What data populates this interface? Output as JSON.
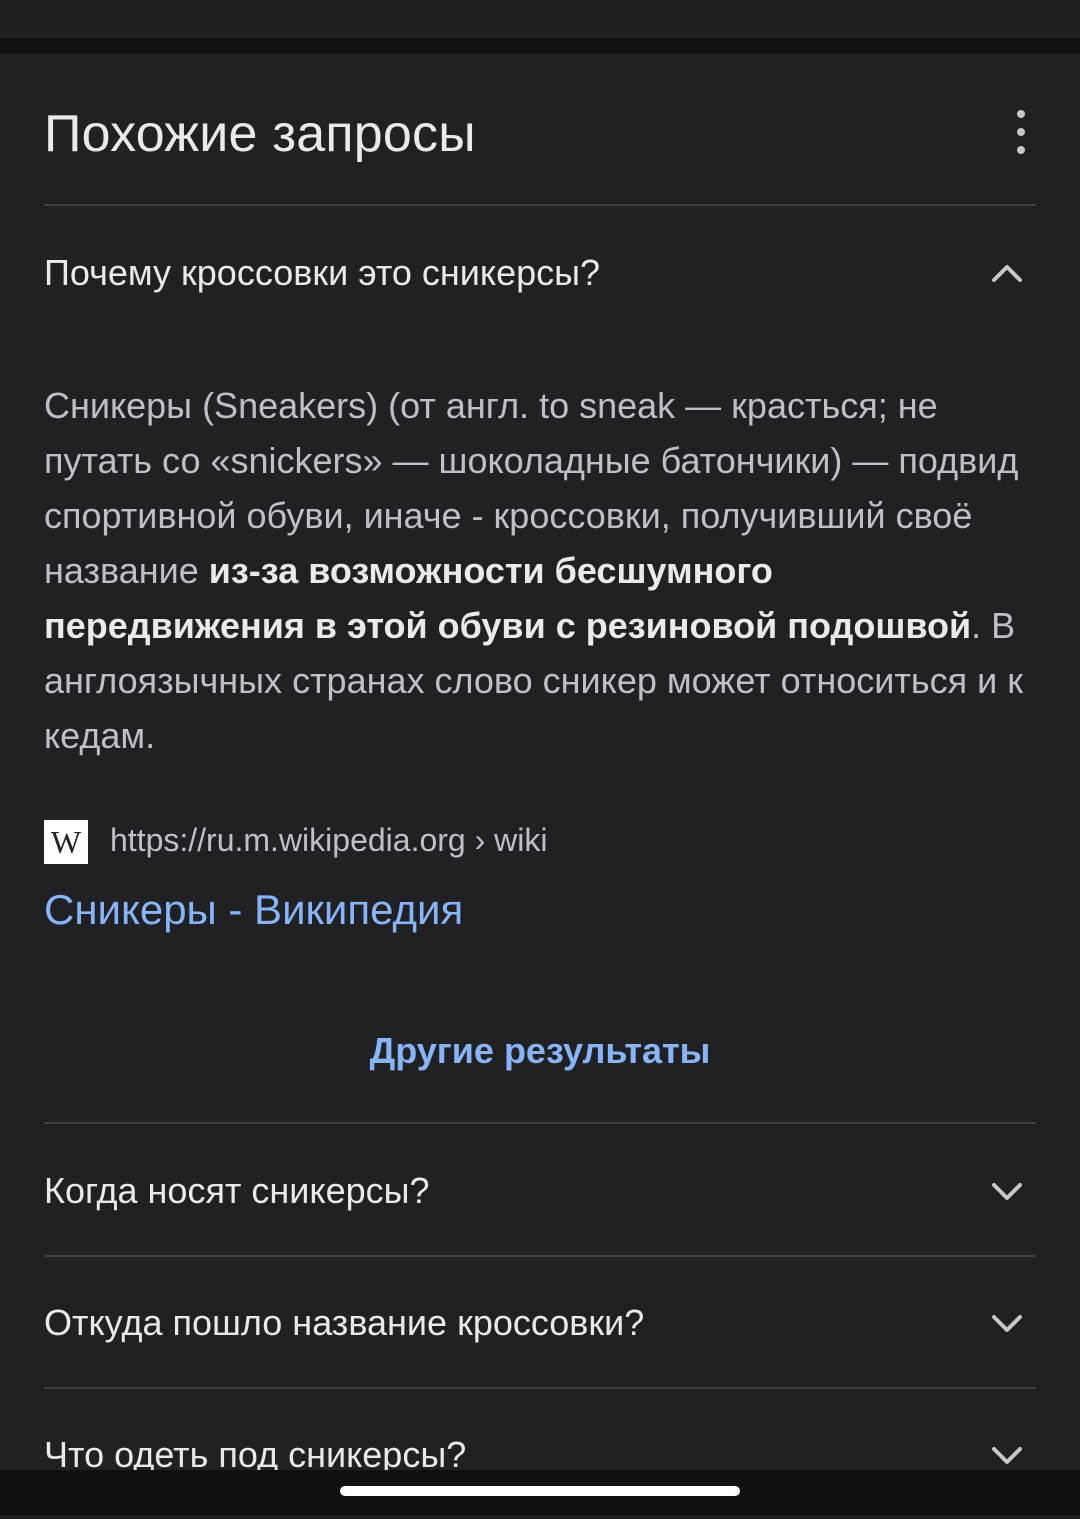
{
  "header": {
    "title": "Похожие запросы",
    "menu_icon": "more-vert-icon"
  },
  "expanded_question": {
    "question": "Почему кроссовки это сникерсы?",
    "chevron_icon": "chevron-up-icon",
    "answer_part1": "Сникеры (Sneakers) (от англ. to sneak — красться; не путать со «snickers» — шоколадные батончики) — подвид спортивной обуви, иначе - кроссовки, получивший своё название ",
    "answer_bold": "из-за возможности бесшумного передвижения в этой обуви с резиновой подошвой",
    "answer_part2": ". В англоязычных странах слово сникер может относиться и к кедам.",
    "source": {
      "logo_text": "W",
      "url": "https://ru.m.wikipedia.org › wiki",
      "title": "Сникеры - Википедия"
    },
    "more_results": "Другие результаты"
  },
  "questions": [
    {
      "label": "Когда носят сникерсы?",
      "icon": "chevron-down-icon"
    },
    {
      "label": "Откуда пошло название кроссовки?",
      "icon": "chevron-down-icon"
    },
    {
      "label": "Что одеть под сникерсы?",
      "icon": "chevron-down-icon"
    }
  ],
  "colors": {
    "background": "#202124",
    "text": "#e8eaed",
    "link": "#8ab4f8"
  }
}
